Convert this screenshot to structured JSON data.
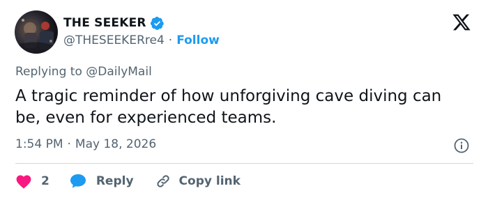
{
  "author": {
    "display_name": "THE SEEKER",
    "handle": "@THESEEKERre4",
    "separator": "·",
    "follow_label": "Follow",
    "verified": true
  },
  "brand": {
    "logo_icon": "x-logo-icon"
  },
  "reply_context": {
    "prefix": "Replying to ",
    "mention": "@DailyMail"
  },
  "tweet": {
    "text": "A tragic reminder of how unforgiving cave diving can be, even for experienced teams.",
    "time": "1:54 PM",
    "separator": "·",
    "date": "May 18, 2026"
  },
  "actions": {
    "like_count": "2",
    "reply_label": "Reply",
    "copy_link_label": "Copy link"
  },
  "colors": {
    "text_primary": "#0f1419",
    "text_secondary": "#536471",
    "accent_blue": "#1d9bf0",
    "like_pink": "#f91880",
    "divider": "#cfd9de"
  }
}
